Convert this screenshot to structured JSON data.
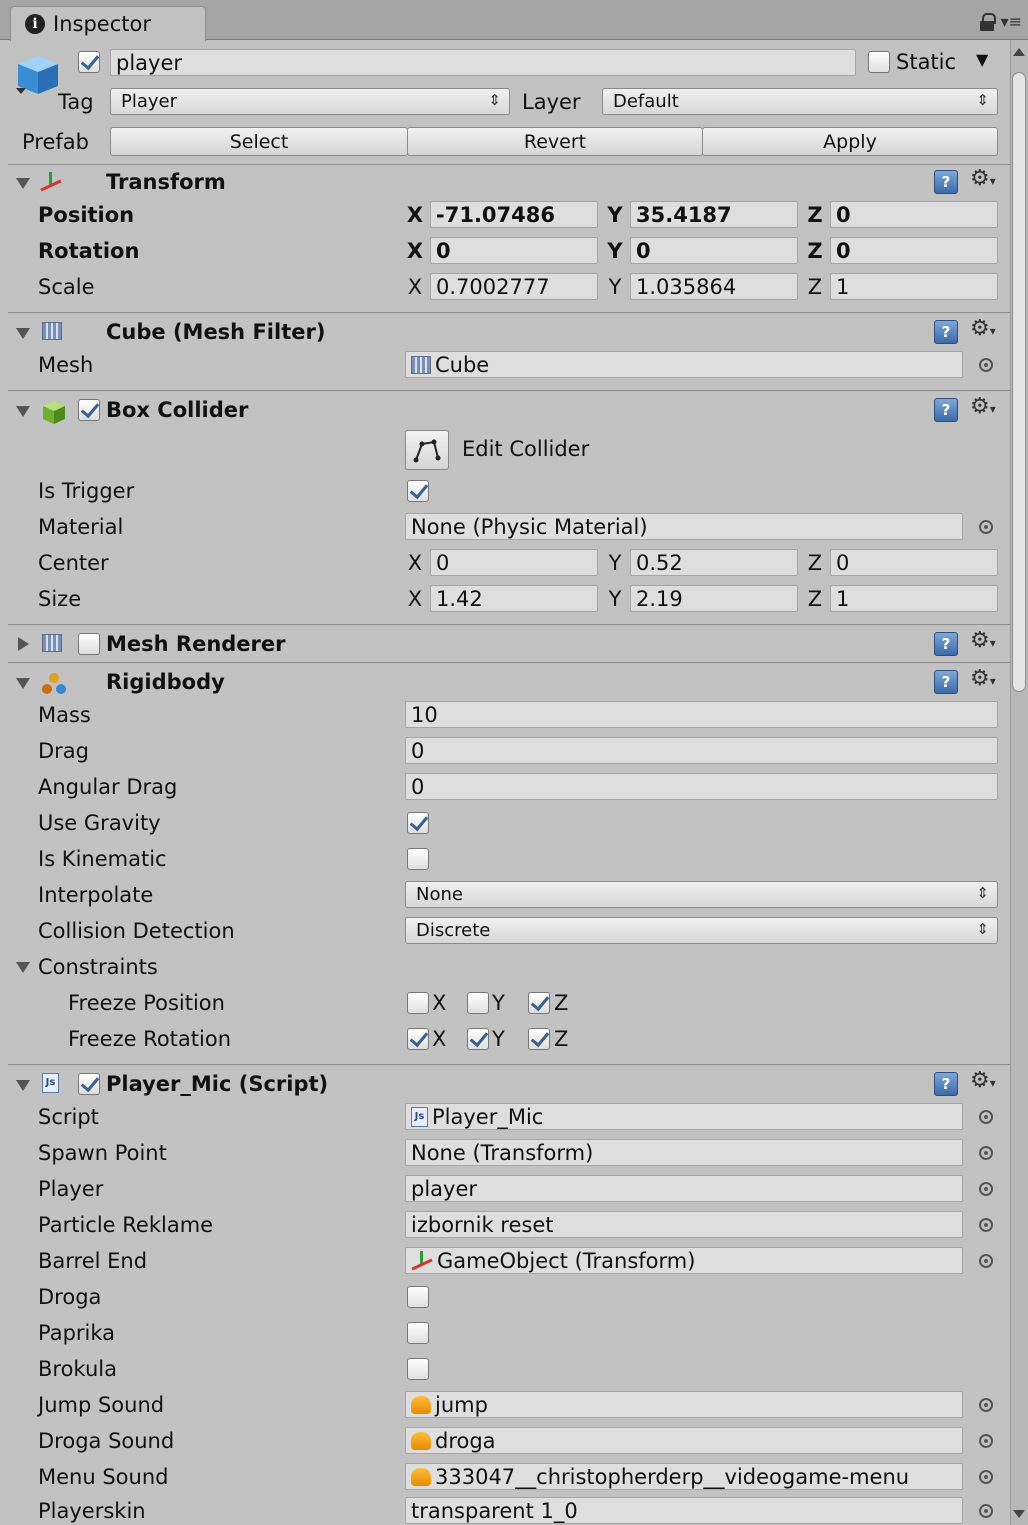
{
  "window": {
    "tab_title": "Inspector"
  },
  "object": {
    "name": "player",
    "static_label": "Static",
    "tag_label": "Tag",
    "tag_value": "Player",
    "layer_label": "Layer",
    "layer_value": "Default",
    "prefab_label": "Prefab",
    "prefab_buttons": [
      "Select",
      "Revert",
      "Apply"
    ]
  },
  "transform": {
    "title": "Transform",
    "position_label": "Position",
    "rotation_label": "Rotation",
    "scale_label": "Scale",
    "position": {
      "x": "-71.07486",
      "y": "35.4187",
      "z": "0"
    },
    "rotation": {
      "x": "0",
      "y": "0",
      "z": "0"
    },
    "scale": {
      "x": "0.7002777",
      "y": "1.035864",
      "z": "1"
    }
  },
  "mesh_filter": {
    "title": "Cube (Mesh Filter)",
    "mesh_label": "Mesh",
    "mesh_value": "Cube"
  },
  "box_collider": {
    "title": "Box Collider",
    "edit_label": "Edit Collider",
    "is_trigger_label": "Is Trigger",
    "material_label": "Material",
    "material_value": "None (Physic Material)",
    "center_label": "Center",
    "center": {
      "x": "0",
      "y": "0.52",
      "z": "0"
    },
    "size_label": "Size",
    "size": {
      "x": "1.42",
      "y": "2.19",
      "z": "1"
    }
  },
  "mesh_renderer": {
    "title": "Mesh Renderer"
  },
  "rigidbody": {
    "title": "Rigidbody",
    "mass_label": "Mass",
    "mass": "10",
    "drag_label": "Drag",
    "drag": "0",
    "angular_drag_label": "Angular Drag",
    "angular_drag": "0",
    "use_gravity_label": "Use Gravity",
    "is_kinematic_label": "Is Kinematic",
    "interpolate_label": "Interpolate",
    "interpolate": "None",
    "collision_label": "Collision Detection",
    "collision": "Discrete",
    "constraints_label": "Constraints",
    "freeze_position_label": "Freeze Position",
    "freeze_rotation_label": "Freeze Rotation",
    "axes": {
      "x": "X",
      "y": "Y",
      "z": "Z"
    }
  },
  "script": {
    "title": "Player_Mic (Script)",
    "fields": [
      {
        "label": "Script",
        "value": "Player_Mic"
      },
      {
        "label": "Spawn Point",
        "value": "None (Transform)"
      },
      {
        "label": "Player",
        "value": "player"
      },
      {
        "label": "Particle Reklame",
        "value": "izbornik reset"
      },
      {
        "label": "Barrel End",
        "value": "GameObject (Transform)"
      },
      {
        "label": "Droga"
      },
      {
        "label": "Paprika"
      },
      {
        "label": "Brokula"
      },
      {
        "label": "Jump Sound",
        "value": "jump"
      },
      {
        "label": "Droga Sound",
        "value": "droga"
      },
      {
        "label": "Menu Sound",
        "value": "333047__christopherderp__videogame-menu"
      },
      {
        "label": "Playerskin",
        "value": "transparent 1_0"
      }
    ]
  },
  "axis_labels": {
    "x": "X",
    "y": "Y",
    "z": "Z"
  },
  "help_glyph": "?"
}
